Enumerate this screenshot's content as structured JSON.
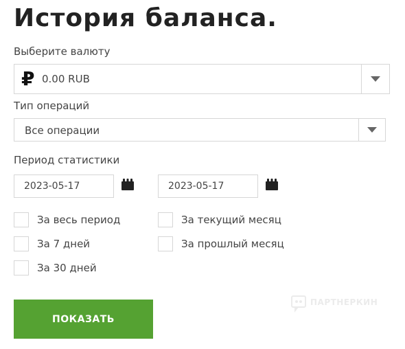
{
  "page": {
    "title": "История баланса."
  },
  "currency": {
    "label": "Выберите валюту",
    "icon": "ruble-icon",
    "icon_glyph": "₽",
    "value": "0.00 RUB"
  },
  "operations": {
    "label": "Тип операций",
    "value": "Все операции"
  },
  "period": {
    "label": "Период статистики",
    "date_from": "2023-05-17",
    "date_to": "2023-05-17",
    "checkboxes": [
      {
        "label": "За весь период",
        "checked": false
      },
      {
        "label": "За текущий месяц",
        "checked": false
      },
      {
        "label": "За 7 дней",
        "checked": false
      },
      {
        "label": "За прошлый месяц",
        "checked": false
      },
      {
        "label": "За 30 дней",
        "checked": false
      }
    ]
  },
  "actions": {
    "show_label": "ПОКАЗАТЬ"
  },
  "watermark": {
    "text": "ПАРТНЕРКИН"
  },
  "colors": {
    "button": "#55a232",
    "border": "#d6d6d6",
    "text": "#444444"
  }
}
